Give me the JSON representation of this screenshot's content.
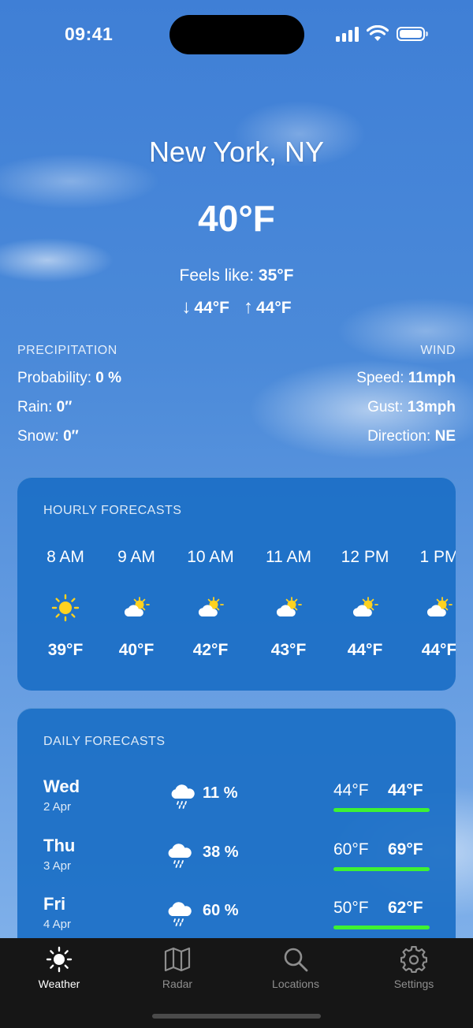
{
  "status": {
    "time": "09:41"
  },
  "location": {
    "city": "New York, NY"
  },
  "current": {
    "temp": "40°F",
    "feels_label": "Feels like:",
    "feels_value": "35°F",
    "low": "44°F",
    "high": "44°F",
    "low_icon": "arrow-down-icon",
    "high_icon": "arrow-up-icon"
  },
  "precipitation": {
    "title": "PRECIPITATION",
    "probability_label": "Probability:",
    "probability_value": "0 %",
    "rain_label": "Rain:",
    "rain_value": "0″",
    "snow_label": "Snow:",
    "snow_value": "0″"
  },
  "wind": {
    "title": "WIND",
    "speed_label": "Speed:",
    "speed_value": "11mph",
    "gust_label": "Gust:",
    "gust_value": "13mph",
    "direction_label": "Direction:",
    "direction_value": "NE"
  },
  "hourly": {
    "title": "HOURLY FORECASTS",
    "items": [
      {
        "hour": "8 AM",
        "icon": "sun-icon",
        "temp": "39°F"
      },
      {
        "hour": "9 AM",
        "icon": "partly-cloudy-icon",
        "temp": "40°F"
      },
      {
        "hour": "10 AM",
        "icon": "partly-cloudy-icon",
        "temp": "42°F"
      },
      {
        "hour": "11 AM",
        "icon": "partly-cloudy-icon",
        "temp": "43°F"
      },
      {
        "hour": "12 PM",
        "icon": "partly-cloudy-icon",
        "temp": "44°F"
      },
      {
        "hour": "1 PM",
        "icon": "partly-cloudy-icon",
        "temp": "44°F"
      }
    ]
  },
  "daily": {
    "title": "DAILY FORECASTS",
    "items": [
      {
        "day": "Wed",
        "date": "2 Apr",
        "icon": "rain-cloud-icon",
        "probability": "11 %",
        "low": "44°F",
        "high": "44°F"
      },
      {
        "day": "Thu",
        "date": "3 Apr",
        "icon": "rain-cloud-icon",
        "probability": "38 %",
        "low": "60°F",
        "high": "69°F"
      },
      {
        "day": "Fri",
        "date": "4 Apr",
        "icon": "rain-cloud-icon",
        "probability": "60 %",
        "low": "50°F",
        "high": "62°F"
      }
    ]
  },
  "tabs": [
    {
      "label": "Weather",
      "icon": "sun-icon",
      "active": true
    },
    {
      "label": "Radar",
      "icon": "map-icon",
      "active": false
    },
    {
      "label": "Locations",
      "icon": "magnifier-icon",
      "active": false
    },
    {
      "label": "Settings",
      "icon": "gear-icon",
      "active": false
    }
  ],
  "colors": {
    "card": "#1b6fc5",
    "range_bar": "#3ef233",
    "sun": "#ffd21f",
    "tabbar": "#161616"
  }
}
